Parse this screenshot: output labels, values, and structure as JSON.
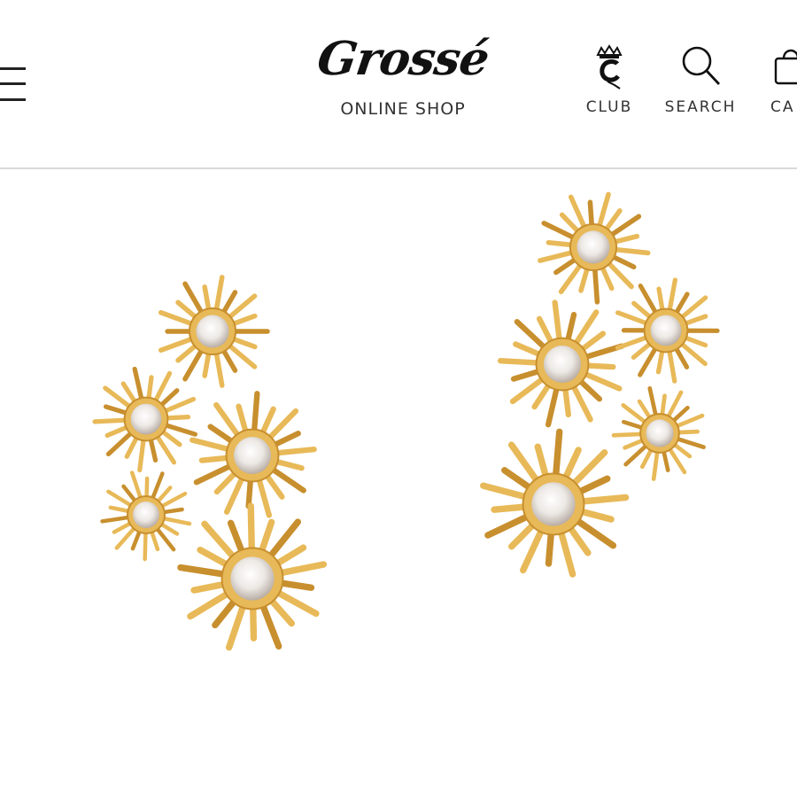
{
  "header": {
    "menu_icon": "hamburger-icon",
    "logo_text": "Grossé",
    "logo_subtitle": "ONLINE SHOP",
    "nav": [
      {
        "label": "CLUB",
        "icon": "club-crown-icon"
      },
      {
        "label": "SEARCH",
        "icon": "search-icon"
      },
      {
        "label": "CA",
        "icon": "cart-bag-icon"
      }
    ]
  },
  "product": {
    "image_alt": "gold starburst flower cluster earrings with crystals",
    "colors": {
      "gold": "#e8b958",
      "gold_dark": "#c88f2e",
      "crystal": "#f4f2f0"
    }
  }
}
